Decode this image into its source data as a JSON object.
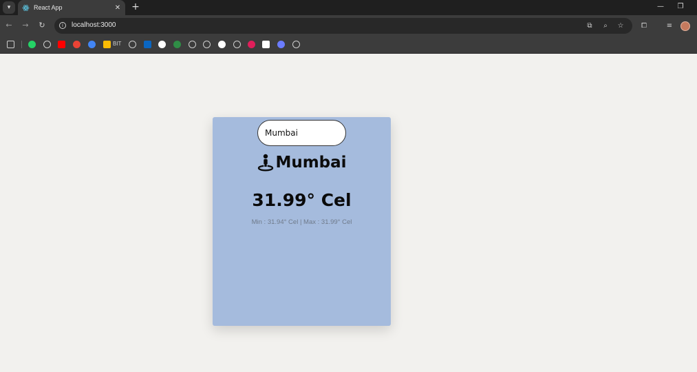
{
  "browser": {
    "tab_title": "React App",
    "url": "localhost:3000",
    "bookmarks": [
      {
        "icon": "apps-grid-icon",
        "color": "#cfcfcf"
      },
      {
        "icon": "whatsapp-icon",
        "color": "#25d366"
      },
      {
        "icon": "globe-icon",
        "color": "#cfcfcf"
      },
      {
        "icon": "youtube-icon",
        "color": "#ff0000"
      },
      {
        "icon": "gmail-icon",
        "color": "#ea4335"
      },
      {
        "icon": "google-icon",
        "color": "#4285f4"
      },
      {
        "icon": "drive-icon",
        "color": "#fbbc04"
      },
      {
        "icon": "globe-icon",
        "color": "#cfcfcf"
      },
      {
        "icon": "linkedin-icon",
        "color": "#0a66c2"
      },
      {
        "icon": "threads-icon",
        "color": "#ffffff"
      },
      {
        "icon": "geeksforgeeks-icon",
        "color": "#2f8d46"
      },
      {
        "icon": "globe-icon",
        "color": "#cfcfcf"
      },
      {
        "icon": "globe-icon",
        "color": "#cfcfcf"
      },
      {
        "icon": "github-icon",
        "color": "#ffffff"
      },
      {
        "icon": "globe-icon",
        "color": "#cfcfcf"
      },
      {
        "icon": "slack-icon",
        "color": "#e01e5a"
      },
      {
        "icon": "wordmark-icon",
        "color": "#ffffff"
      },
      {
        "icon": "copilot-icon",
        "color": "#6b7cff"
      },
      {
        "icon": "refresh-link-icon",
        "color": "#cfcfcf"
      }
    ],
    "bookmark_text": "BIT"
  },
  "weather": {
    "search_value": "Mumbai",
    "city": "Mumbai",
    "temperature": "31.99° Cel",
    "minmax": "Min : 31.94° Cel | Max : 31.99° Cel"
  },
  "colors": {
    "card_bg": "#a5bbdd",
    "page_bg": "#f2f1ee"
  }
}
